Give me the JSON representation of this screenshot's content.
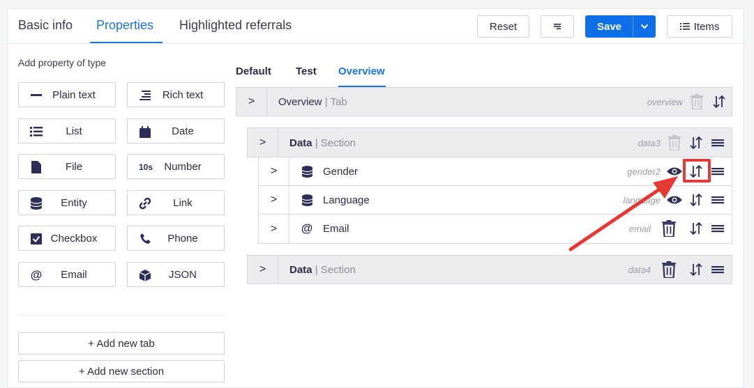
{
  "top_tabs": [
    "Basic info",
    "Properties",
    "Highlighted referrals"
  ],
  "toolbar": {
    "reset": "Reset",
    "save": "Save",
    "items": "Items"
  },
  "left": {
    "add_label": "Add property of type",
    "types": [
      {
        "label": "Plain text",
        "icon": "minus-icon"
      },
      {
        "label": "Rich text",
        "icon": "align-right-icon"
      },
      {
        "label": "List",
        "icon": "list-icon"
      },
      {
        "label": "Date",
        "icon": "calendar-icon"
      },
      {
        "label": "File",
        "icon": "file-icon"
      },
      {
        "label": "Number",
        "icon": "10s"
      },
      {
        "label": "Entity",
        "icon": "database-icon"
      },
      {
        "label": "Link",
        "icon": "link-icon"
      },
      {
        "label": "Checkbox",
        "icon": "checkbox-icon"
      },
      {
        "label": "Phone",
        "icon": "phone-icon"
      },
      {
        "label": "Email",
        "icon": "at-icon"
      },
      {
        "label": "JSON",
        "icon": "cube-icon"
      }
    ],
    "add_tab": "+ Add new tab",
    "add_section": "+ Add new section"
  },
  "sub_tabs": [
    "Default",
    "Test",
    "Overview"
  ],
  "tree": {
    "tab": {
      "name": "Overview",
      "type": "Tab",
      "key": "overview"
    },
    "section1": {
      "name": "Data",
      "type": "Section",
      "key": "data3"
    },
    "fields": [
      {
        "name": "Gender",
        "key": "gender2"
      },
      {
        "name": "Language",
        "key": "language"
      },
      {
        "name": "Email",
        "key": "email"
      }
    ],
    "section2": {
      "name": "Data",
      "type": "Section",
      "key": "data4"
    }
  },
  "colors": {
    "accent": "#1a73e8",
    "save": "#0f6fe8",
    "annotation": "#e53935"
  }
}
